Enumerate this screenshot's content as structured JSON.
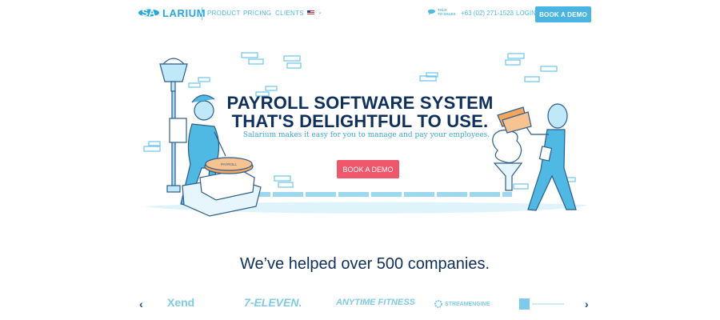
{
  "nav": {
    "logo_badge": "SA",
    "logo_rest": "LARIUM",
    "links": [
      "PRODUCT",
      "PRICING",
      "CLIENTS"
    ],
    "flag_icon": "us-flag-icon",
    "talk_label_1": "TALK",
    "talk_label_2": "TO SALES",
    "phone": "+63 (02) 271-1523",
    "separator": "|",
    "login": "LOGIN",
    "book_demo": "BOOK A DEMO"
  },
  "hero": {
    "headline_1": "PAYROLL SOFTWARE SYSTEM",
    "headline_2": "THAT'S DELIGHTFUL TO USE.",
    "subline": "Salarium makes it easy for you to manage and pay your employees.",
    "cta": "BOOK A DEMO",
    "machine_label": "PAYROLL"
  },
  "clients": {
    "heading": "We’ve helped over 500 companies.",
    "logos": [
      "Xend",
      "7-ELEVEN.",
      "ANYTIME FITNESS",
      "STREAMENGINE"
    ],
    "prev_icon": "chevron-left-icon",
    "next_icon": "chevron-right-icon"
  },
  "colors": {
    "brand_blue": "#23a9dd",
    "navy": "#0f2f5c",
    "cta_red": "#f0576b"
  }
}
